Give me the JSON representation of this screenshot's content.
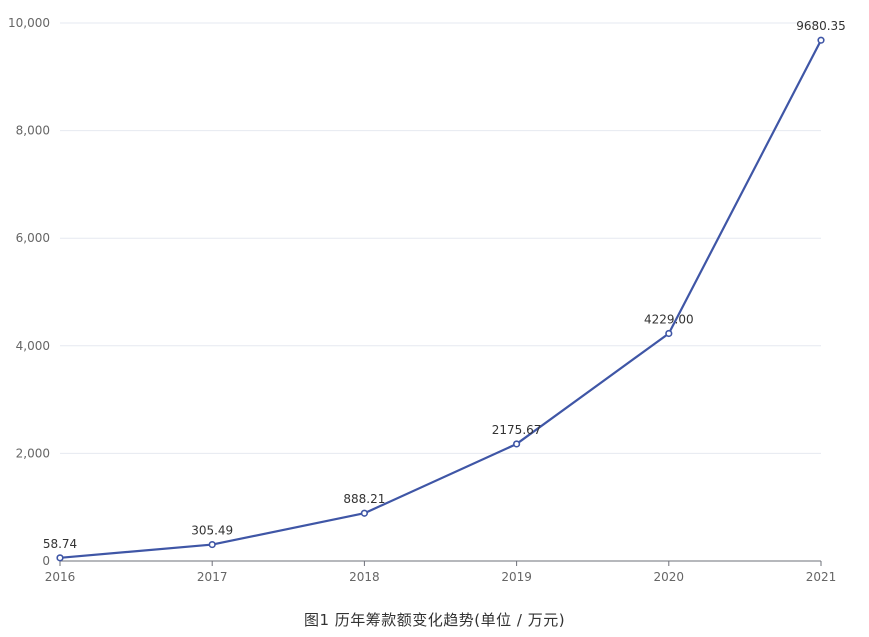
{
  "chart_data": {
    "type": "line",
    "title": "图1  历年筹款额变化趋势(单位 / 万元)",
    "xlabel": "",
    "ylabel": "",
    "categories": [
      "2016",
      "2017",
      "2018",
      "2019",
      "2020",
      "2021"
    ],
    "series": [
      {
        "values": [
          58.74,
          305.49,
          888.21,
          2175.67,
          4229.0,
          9680.35
        ],
        "labels": [
          "58.74",
          "305.49",
          "888.21",
          "2175.67",
          "4229.00",
          "9680.35"
        ]
      }
    ],
    "ylim": [
      0,
      10000
    ],
    "yticks": [
      0,
      2000,
      4000,
      6000,
      8000,
      10000
    ],
    "ytick_labels": [
      "0",
      "2,000",
      "4,000",
      "6,000",
      "8,000",
      "10,000"
    ],
    "grid": true,
    "legend": "none",
    "colors": {
      "line": "#3f56a6",
      "grid": "#e6e9f0",
      "axis": "#6e7079"
    }
  }
}
